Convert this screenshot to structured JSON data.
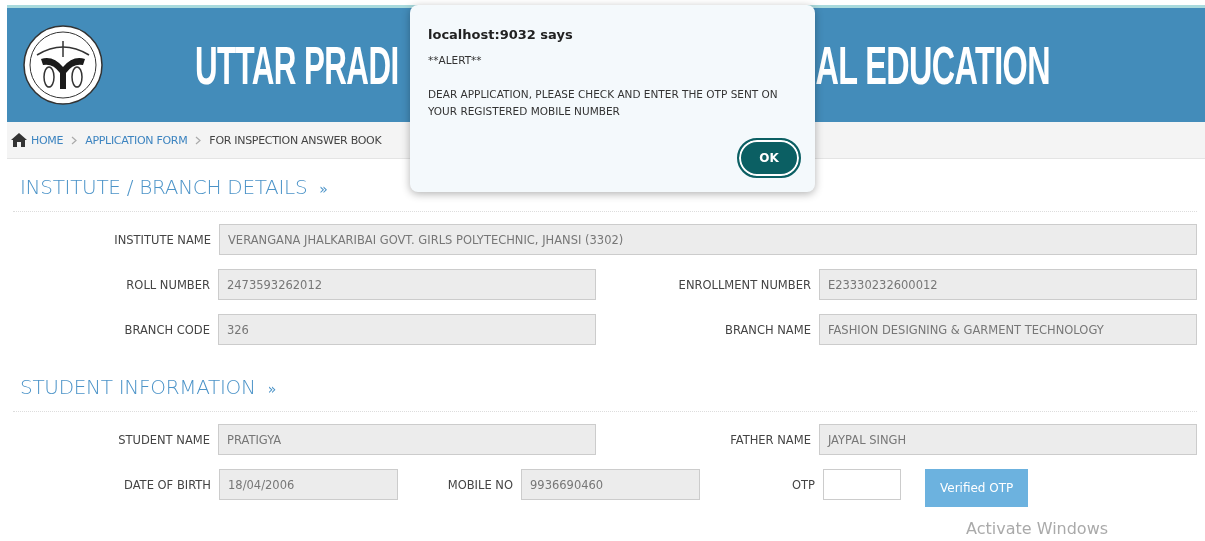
{
  "header": {
    "title_left": "UTTAR PRADI",
    "title_right": "AL EDUCATION"
  },
  "breadcrumb": [
    {
      "label": "HOME",
      "kind": "link"
    },
    {
      "label": "APPLICATION FORM",
      "kind": "link"
    },
    {
      "label": "FOR INSPECTION ANSWER BOOK",
      "kind": "current"
    }
  ],
  "sections": [
    {
      "title": "INSTITUTE / BRANCH DETAILS",
      "mark": "»",
      "rows": [
        {
          "fields": [
            {
              "label": "INSTITUTE NAME",
              "value": "VERANGANA JHALKARIBAI GOVT. GIRLS POLYTECHNIC, JHANSI (3302)",
              "kind": "text"
            }
          ]
        },
        {
          "fields": [
            {
              "label": "ROLL NUMBER",
              "value": "2473593262012",
              "kind": "text"
            },
            {
              "label": "ENROLLMENT NUMBER",
              "value": "E23330232600012",
              "kind": "text"
            }
          ]
        },
        {
          "fields": [
            {
              "label": "BRANCH CODE",
              "value": "326",
              "kind": "text"
            },
            {
              "label": "BRANCH NAME",
              "value": "FASHION DESIGNING & GARMENT TECHNOLOGY",
              "kind": "text"
            }
          ]
        }
      ]
    },
    {
      "title": "STUDENT INFORMATION",
      "mark": "»",
      "rows": [
        {
          "fields": [
            {
              "label": "STUDENT NAME",
              "value": "PRATIGYA",
              "kind": "text"
            },
            {
              "label": "FATHER NAME",
              "value": "JAYPAL SINGH",
              "kind": "text"
            }
          ]
        },
        {
          "fields": [
            {
              "label": "DATE OF BIRTH",
              "value": "18/04/2006",
              "kind": "text"
            },
            {
              "label": "MOBILE NO",
              "value": "9936690460",
              "kind": "text"
            },
            {
              "label": "OTP",
              "kind": "otp"
            },
            {
              "label": "Verified OTP",
              "kind": "button"
            }
          ]
        }
      ]
    }
  ],
  "dialog": {
    "origin": "localhost:9032 says",
    "heading": "**ALERT**",
    "message": "DEAR APPLICATION, PLEASE CHECK AND ENTER THE OTP SENT ON YOUR REGISTERED MOBILE NUMBER",
    "button": "OK"
  },
  "os_notice": "Activate Windows"
}
